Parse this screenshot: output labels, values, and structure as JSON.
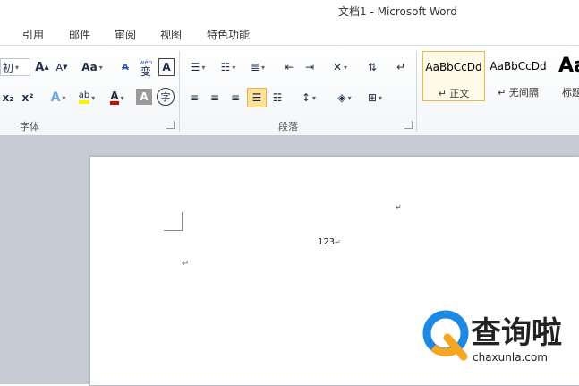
{
  "window": {
    "title": "文档1 - Microsoft Word"
  },
  "ribbon_tabs": [
    "引用",
    "邮件",
    "审阅",
    "视图",
    "特色功能"
  ],
  "font_group": {
    "label": "字体",
    "font_size_fragment": "初",
    "grow_font": "A",
    "shrink_font": "A",
    "change_case": "Aa",
    "clear_format": "A",
    "phonetic": "wén",
    "phonetic_char": "变",
    "char_border": "A",
    "subscript": "x₂",
    "superscript": "x²",
    "text_effect": "A",
    "highlight": "ab",
    "font_color": "A",
    "char_shading": "A",
    "enclose_char": "字"
  },
  "paragraph_group": {
    "label": "段落"
  },
  "styles_group": {
    "styles": [
      {
        "sample": "AaBbCcDd",
        "name": "正文"
      },
      {
        "sample": "AaBbCcDd",
        "name": "无间隔"
      },
      {
        "sample": "Aa",
        "name": "标题"
      }
    ]
  },
  "document": {
    "body_text": "123",
    "paragraph_mark": "↵"
  },
  "watermark": {
    "name": "查询啦",
    "url": "chaxunla.com",
    "logo_color": "#1e88e5"
  }
}
